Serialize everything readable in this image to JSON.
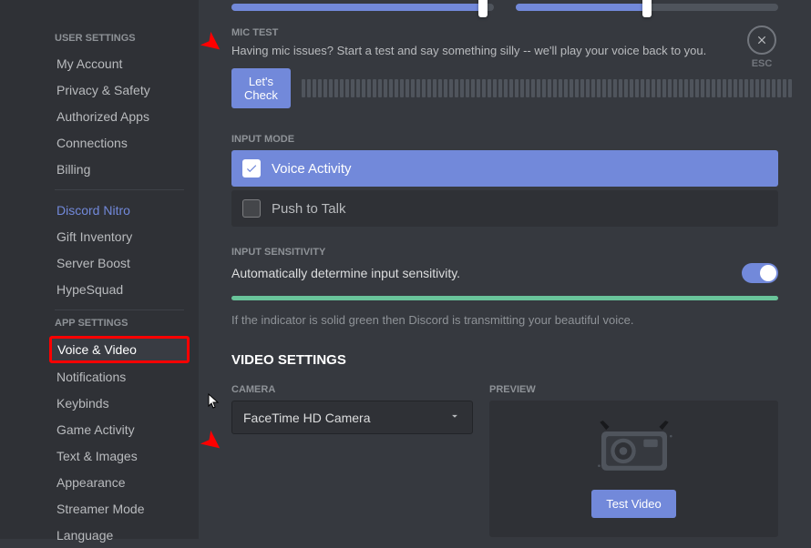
{
  "sidebar": {
    "userSettingsHeader": "USER SETTINGS",
    "appSettingsHeader": "APP SETTINGS",
    "userItems": [
      {
        "label": "My Account"
      },
      {
        "label": "Privacy & Safety"
      },
      {
        "label": "Authorized Apps"
      },
      {
        "label": "Connections"
      },
      {
        "label": "Billing"
      }
    ],
    "nitroItems": [
      {
        "label": "Discord Nitro"
      },
      {
        "label": "Gift Inventory"
      },
      {
        "label": "Server Boost"
      },
      {
        "label": "HypeSquad"
      }
    ],
    "appItems": [
      {
        "label": "Voice & Video"
      },
      {
        "label": "Notifications"
      },
      {
        "label": "Keybinds"
      },
      {
        "label": "Game Activity"
      },
      {
        "label": "Text & Images"
      },
      {
        "label": "Appearance"
      },
      {
        "label": "Streamer Mode"
      },
      {
        "label": "Language"
      }
    ]
  },
  "escLabel": "ESC",
  "micTest": {
    "header": "MIC TEST",
    "desc": "Having mic issues? Start a test and say something silly -- we'll play your voice back to you.",
    "button": "Let's Check"
  },
  "sliders": {
    "slider1Percent": 96,
    "slider2Percent": 50
  },
  "inputMode": {
    "header": "INPUT MODE",
    "optionA": "Voice Activity",
    "optionB": "Push to Talk"
  },
  "inputSensitivity": {
    "header": "INPUT SENSITIVITY",
    "desc": "Automatically determine input sensitivity.",
    "indicatorText": "If the indicator is solid green then Discord is transmitting your beautiful voice."
  },
  "videoSettings": {
    "heading": "VIDEO SETTINGS",
    "cameraLabel": "CAMERA",
    "cameraValue": "FaceTime HD Camera",
    "previewLabel": "PREVIEW",
    "testButton": "Test Video"
  }
}
